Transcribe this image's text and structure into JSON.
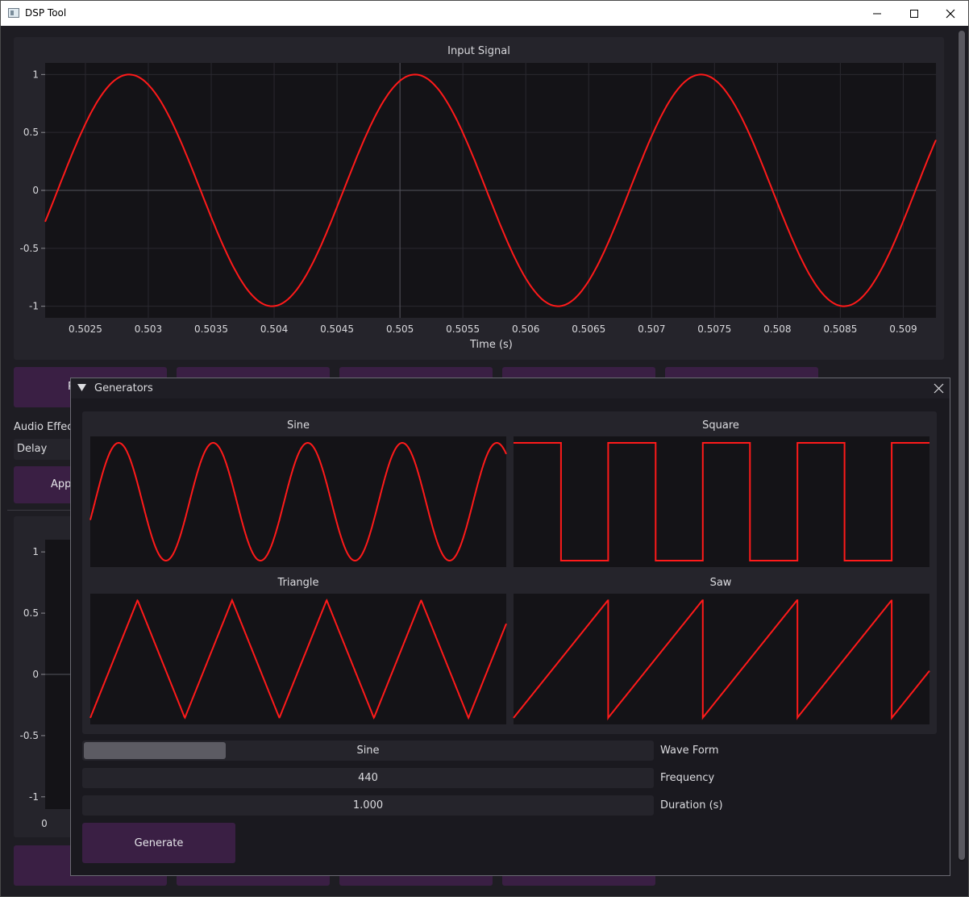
{
  "window": {
    "title": "DSP Tool"
  },
  "input_plot": {
    "title": "Input Signal",
    "xlabel": "Time (s)",
    "yticks": [
      "1",
      "0.5",
      "0",
      "-0.5",
      "-1"
    ],
    "xticks": [
      "0.5025",
      "0.503",
      "0.5035",
      "0.504",
      "0.5045",
      "0.505",
      "0.5055",
      "0.506",
      "0.5065",
      "0.507",
      "0.5075",
      "0.508",
      "0.5085",
      "0.509"
    ]
  },
  "audio_effects": {
    "label": "Audio Effec",
    "selected": "Delay",
    "apply_label": "App"
  },
  "row_button_label": "P",
  "output_plot": {
    "yticks": [
      "1",
      "0.5",
      "0",
      "-0.5",
      "-1"
    ],
    "xtick0": "0"
  },
  "generators": {
    "title": "Generators",
    "plots": {
      "sine": "Sine",
      "square": "Square",
      "triangle": "Triangle",
      "saw": "Saw"
    },
    "wave_form": {
      "value": "Sine",
      "label": "Wave Form",
      "slider_fraction": 0.25
    },
    "frequency": {
      "value": "440",
      "label": "Frequency"
    },
    "duration": {
      "value": "1.000",
      "label": "Duration (s)"
    },
    "generate_label": "Generate"
  },
  "colors": {
    "signal": "#ff1a1a",
    "button": "#3a1f44",
    "panel": "#25242b",
    "plot_bg": "#141317"
  },
  "chart_data": [
    {
      "type": "line",
      "title": "Input Signal",
      "xlabel": "Time (s)",
      "ylabel": "",
      "xlim": [
        0.50218,
        0.50926
      ],
      "ylim": [
        -1.1,
        1.1
      ],
      "grid": true,
      "frequency_hz": 440,
      "series": [
        {
          "x": [
            0.5022,
            0.50285,
            0.5034,
            0.50398,
            0.50455,
            0.50512,
            0.5057,
            0.50626,
            0.50683,
            0.5074,
            0.50797,
            0.50853,
            0.50926
          ],
          "y": [
            -0.19,
            1.0,
            0.0,
            -1.0,
            0.0,
            1.0,
            0.0,
            -1.0,
            0.0,
            1.0,
            0.0,
            -1.0,
            0.43
          ]
        }
      ]
    },
    {
      "type": "line",
      "title": "",
      "ylim": [
        -1.1,
        1.1
      ],
      "yticks": [
        1,
        0.5,
        0,
        -0.5,
        -1
      ],
      "xticks": [
        0
      ],
      "series": []
    },
    {
      "type": "line",
      "title": "Sine",
      "series": [
        {
          "name": "",
          "waveform": "sine",
          "cycles": 4.4,
          "phase": 0.5
        }
      ]
    },
    {
      "type": "line",
      "title": "Square",
      "series": [
        {
          "name": "",
          "waveform": "square",
          "cycles": 4.4
        }
      ]
    },
    {
      "type": "line",
      "title": "Triangle",
      "series": [
        {
          "name": "",
          "waveform": "triangle",
          "cycles": 4.4
        }
      ]
    },
    {
      "type": "line",
      "title": "Saw",
      "series": [
        {
          "name": "",
          "waveform": "saw",
          "cycles": 4.4
        }
      ]
    }
  ]
}
